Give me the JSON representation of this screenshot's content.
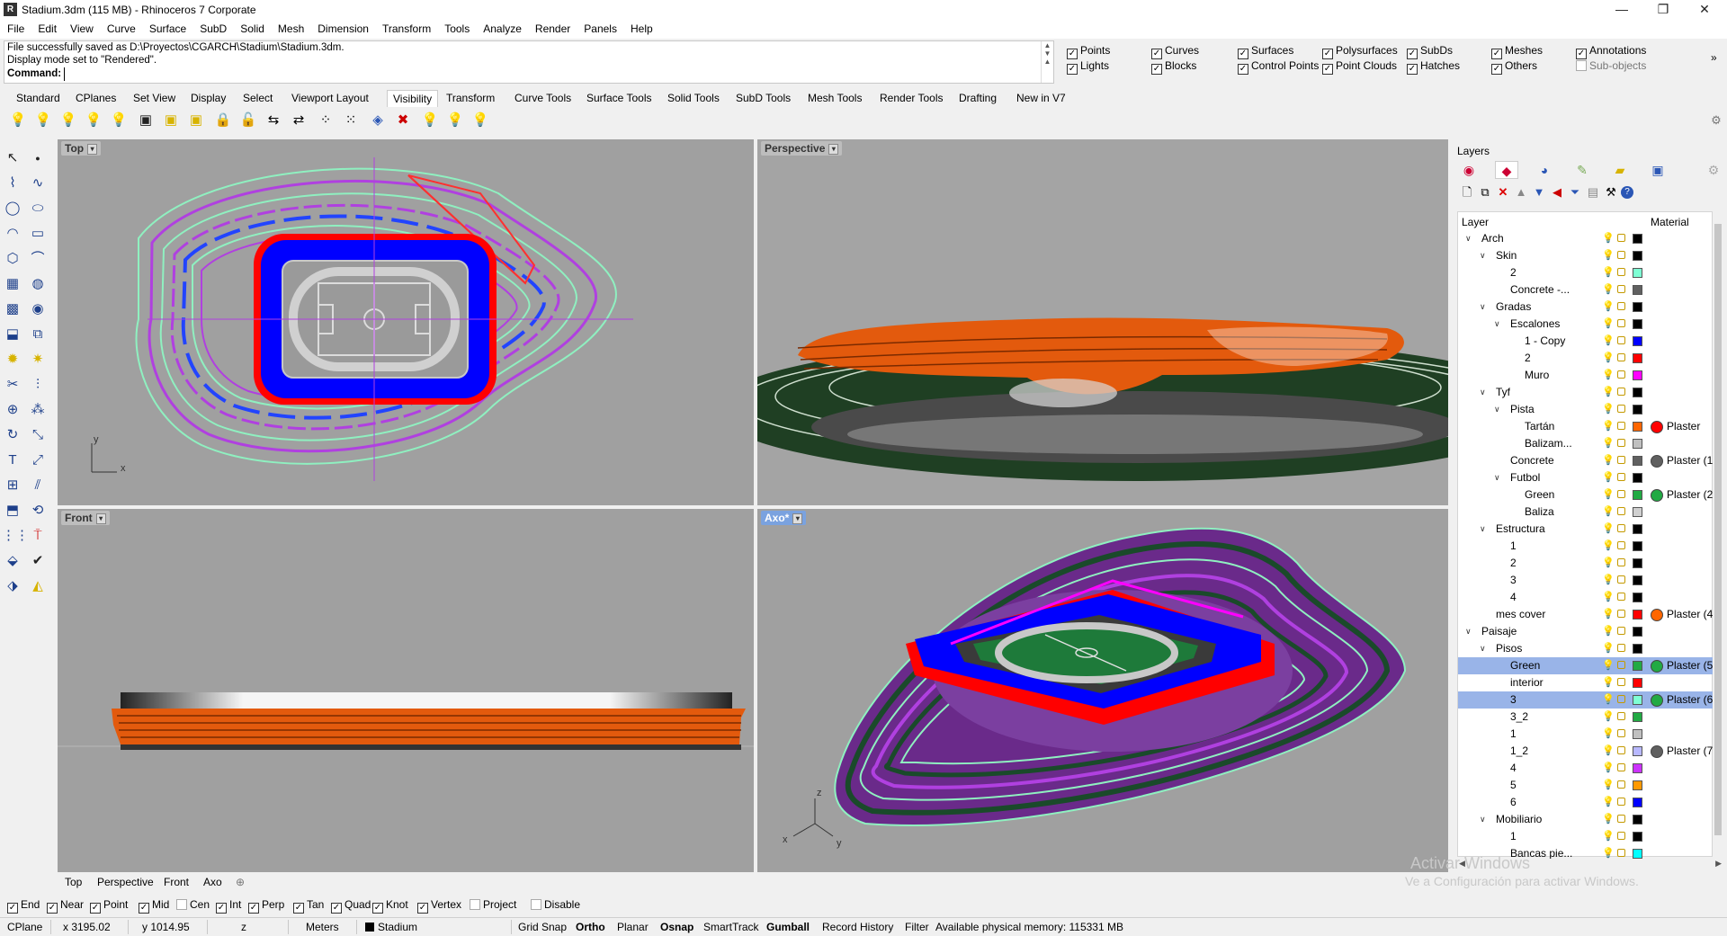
{
  "window": {
    "title": "Stadium.3dm (115 MB) - Rhinoceros 7 Corporate",
    "minimize": "—",
    "maximize": "❐",
    "close": "✕"
  },
  "menu": [
    "File",
    "Edit",
    "View",
    "Curve",
    "Surface",
    "SubD",
    "Solid",
    "Mesh",
    "Dimension",
    "Transform",
    "Tools",
    "Analyze",
    "Render",
    "Panels",
    "Help"
  ],
  "command": {
    "history_1": "File successfully saved as D:\\Proyectos\\CGARCH\\Stadium\\Stadium.3dm.",
    "history_2": "Display mode set to \"Rendered\".",
    "prompt": "Command:"
  },
  "filters": {
    "items": [
      {
        "label": "Points",
        "checked": true
      },
      {
        "label": "Curves",
        "checked": true
      },
      {
        "label": "Surfaces",
        "checked": true
      },
      {
        "label": "Polysurfaces",
        "checked": true
      },
      {
        "label": "SubDs",
        "checked": true
      },
      {
        "label": "Meshes",
        "checked": true
      },
      {
        "label": "Annotations",
        "checked": true
      },
      {
        "label": "Lights",
        "checked": true
      },
      {
        "label": "Blocks",
        "checked": true
      },
      {
        "label": "Control Points",
        "checked": true
      },
      {
        "label": "Point Clouds",
        "checked": true
      },
      {
        "label": "Hatches",
        "checked": true
      },
      {
        "label": "Others",
        "checked": true
      },
      {
        "label": "Sub-objects",
        "checked": false
      }
    ]
  },
  "tabs": [
    "Standard",
    "CPlanes",
    "Set View",
    "Display",
    "Select",
    "Viewport Layout",
    "Visibility",
    "Transform",
    "Curve Tools",
    "Surface Tools",
    "Solid Tools",
    "SubD Tools",
    "Mesh Tools",
    "Render Tools",
    "Drafting",
    "New in V7"
  ],
  "active_tab": "Visibility",
  "viewports": {
    "top": {
      "label": "Top",
      "axis_x": "x",
      "axis_y": "y"
    },
    "perspective": {
      "label": "Perspective"
    },
    "front": {
      "label": "Front"
    },
    "axo": {
      "label": "Axo*",
      "axis_x": "y",
      "axis_y": "z",
      "axis_z": "x"
    }
  },
  "viewport_tabs": [
    "Top",
    "Perspective",
    "Front",
    "Axo"
  ],
  "osnap": [
    {
      "label": "End",
      "checked": true
    },
    {
      "label": "Near",
      "checked": true
    },
    {
      "label": "Point",
      "checked": true
    },
    {
      "label": "Mid",
      "checked": true
    },
    {
      "label": "Cen",
      "checked": false
    },
    {
      "label": "Int",
      "checked": true
    },
    {
      "label": "Perp",
      "checked": true
    },
    {
      "label": "Tan",
      "checked": true
    },
    {
      "label": "Quad",
      "checked": true
    },
    {
      "label": "Knot",
      "checked": true
    },
    {
      "label": "Vertex",
      "checked": true
    },
    {
      "label": "Project",
      "checked": false
    },
    {
      "label": "Disable",
      "checked": false
    }
  ],
  "status": {
    "cplane": "CPlane",
    "x": "x 3195.02",
    "y": "y 1014.95",
    "z": "z",
    "units": "Meters",
    "layer": "Stadium",
    "grid_snap": "Grid Snap",
    "ortho": "Ortho",
    "planar": "Planar",
    "osnap": "Osnap",
    "smarttrack": "SmartTrack",
    "gumball": "Gumball",
    "record_history": "Record History",
    "filter": "Filter",
    "memory": "Available physical memory: 115331 MB"
  },
  "layers_panel": {
    "title": "Layers",
    "col_layer": "Layer",
    "col_material": "Material",
    "rows": [
      {
        "name": "Arch",
        "level": 0,
        "toggle": "∨",
        "color": "#000000",
        "material": ""
      },
      {
        "name": "Skin",
        "level": 1,
        "toggle": "∨",
        "color": "#000000",
        "material": ""
      },
      {
        "name": "2",
        "level": 2,
        "toggle": "",
        "color": "#7fffd4",
        "material": ""
      },
      {
        "name": "Concrete -...",
        "level": 2,
        "toggle": "",
        "color": "#606060",
        "material": ""
      },
      {
        "name": "Gradas",
        "level": 1,
        "toggle": "∨",
        "color": "#000000",
        "material": ""
      },
      {
        "name": "Escalones",
        "level": 2,
        "toggle": "∨",
        "color": "#000000",
        "material": ""
      },
      {
        "name": "1 - Copy",
        "level": 3,
        "toggle": "",
        "color": "#0000ff",
        "material": ""
      },
      {
        "name": "2",
        "level": 3,
        "toggle": "",
        "color": "#ff0000",
        "material": ""
      },
      {
        "name": "Muro",
        "level": 3,
        "toggle": "",
        "color": "#ff00ff",
        "material": ""
      },
      {
        "name": "Tyf",
        "level": 1,
        "toggle": "∨",
        "color": "#000000",
        "material": ""
      },
      {
        "name": "Pista",
        "level": 2,
        "toggle": "∨",
        "color": "#000000",
        "material": ""
      },
      {
        "name": "Tartán",
        "level": 3,
        "toggle": "",
        "color": "#ff6600",
        "material": "Plaster",
        "dot": "#ff0000"
      },
      {
        "name": "Balizam...",
        "level": 3,
        "toggle": "",
        "color": "#c0c0c0",
        "material": ""
      },
      {
        "name": "Concrete",
        "level": 2,
        "toggle": "",
        "color": "#606060",
        "material": "Plaster (1",
        "dot": "#606060"
      },
      {
        "name": "Futbol",
        "level": 2,
        "toggle": "∨",
        "color": "#000000",
        "material": ""
      },
      {
        "name": "Green",
        "level": 3,
        "toggle": "",
        "color": "#22aa44",
        "material": "Plaster (2",
        "dot": "#22aa44"
      },
      {
        "name": "Baliza",
        "level": 3,
        "toggle": "",
        "color": "#d0d0d0",
        "material": ""
      },
      {
        "name": "Estructura",
        "level": 1,
        "toggle": "∨",
        "color": "#000000",
        "material": ""
      },
      {
        "name": "1",
        "level": 2,
        "toggle": "",
        "color": "#000000",
        "material": ""
      },
      {
        "name": "2",
        "level": 2,
        "toggle": "",
        "color": "#000000",
        "material": ""
      },
      {
        "name": "3",
        "level": 2,
        "toggle": "",
        "color": "#000000",
        "material": ""
      },
      {
        "name": "4",
        "level": 2,
        "toggle": "",
        "color": "#000000",
        "material": ""
      },
      {
        "name": "mes cover",
        "level": 1,
        "toggle": "",
        "color": "#ff0000",
        "material": "Plaster (4",
        "dot": "#ff6600"
      },
      {
        "name": "Paisaje",
        "level": 0,
        "toggle": "∨",
        "color": "#000000",
        "material": ""
      },
      {
        "name": "Pisos",
        "level": 1,
        "toggle": "∨",
        "color": "#000000",
        "material": ""
      },
      {
        "name": "Green",
        "level": 2,
        "toggle": "",
        "color": "#22aa44",
        "material": "Plaster (5",
        "dot": "#22aa44",
        "selected": true
      },
      {
        "name": "interior",
        "level": 2,
        "toggle": "",
        "color": "#ff0000",
        "material": ""
      },
      {
        "name": "3",
        "level": 2,
        "toggle": "",
        "color": "#7fffd4",
        "material": "Plaster (6",
        "dot": "#22aa44",
        "selected": true
      },
      {
        "name": "3_2",
        "level": 2,
        "toggle": "",
        "color": "#22aa44",
        "material": ""
      },
      {
        "name": "1",
        "level": 2,
        "toggle": "",
        "color": "#c0c0c0",
        "material": ""
      },
      {
        "name": "1_2",
        "level": 2,
        "toggle": "",
        "color": "#b8b8ff",
        "material": "Plaster (7",
        "dot": "#606060"
      },
      {
        "name": "4",
        "level": 2,
        "toggle": "",
        "color": "#cc33ff",
        "material": ""
      },
      {
        "name": "5",
        "level": 2,
        "toggle": "",
        "color": "#ff9900",
        "material": ""
      },
      {
        "name": "6",
        "level": 2,
        "toggle": "",
        "color": "#0000ff",
        "material": ""
      },
      {
        "name": "Mobiliario",
        "level": 1,
        "toggle": "∨",
        "color": "#000000",
        "material": ""
      },
      {
        "name": "1",
        "level": 2,
        "toggle": "",
        "color": "#000000",
        "material": ""
      },
      {
        "name": "Bancas pie...",
        "level": 2,
        "toggle": "",
        "color": "#00ffff",
        "material": ""
      }
    ]
  },
  "watermark": {
    "line1": "Activar Windows",
    "line2": "Ve a Configuración para activar Windows."
  },
  "colors": {
    "accent": "#7aa2df",
    "selection": "#99b4e8",
    "viewport_bg": "#a0a0a0"
  }
}
